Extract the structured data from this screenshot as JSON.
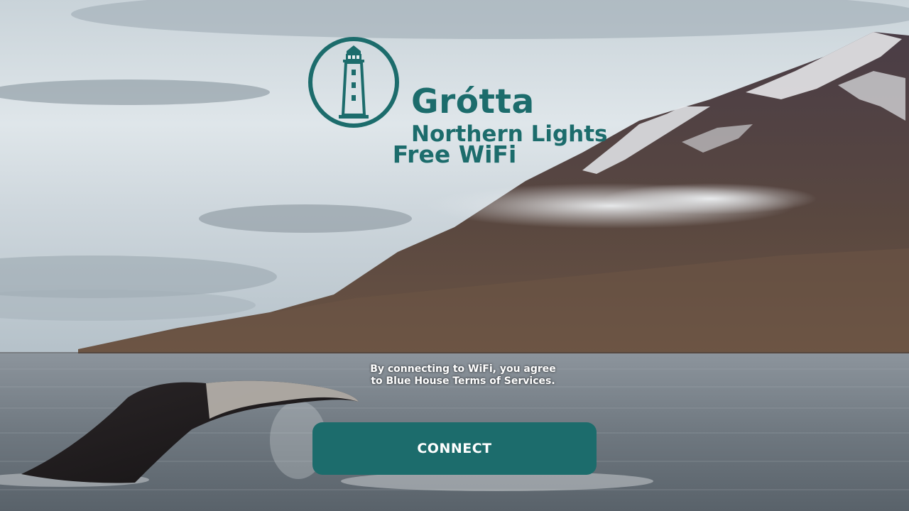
{
  "brand": {
    "name": "Grótta",
    "subtitle": "Northern Lights",
    "color": "#1c6c6c"
  },
  "portal": {
    "title": "Free WiFi",
    "terms_line1": "By connecting to WiFi, you agree",
    "terms_line2": "to Blue House Terms of Services.",
    "connect_label": "CONNECT"
  },
  "icons": {
    "logo": "lighthouse-icon"
  }
}
